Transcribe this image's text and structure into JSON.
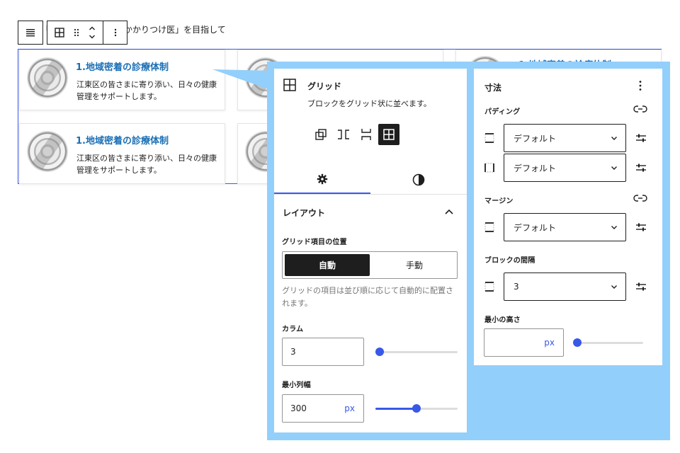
{
  "canvas": {
    "heading_text": "かかりつけ医」を目指して",
    "heading_prefix": "「",
    "cards": [
      {
        "title": "1.地域密着の診療体制",
        "desc": "江東区の皆さまに寄り添い、日々の健康管理をサポートします。"
      },
      {
        "title": "1.地域密着の診療体制",
        "desc": "江東区の皆さまに寄り添い、日々の健康管理をサポートします。"
      }
    ],
    "ghost_title": "1.地域密着の診療体制"
  },
  "block_toolbar": {
    "icons": [
      "list-view-icon",
      "grid-icon",
      "drag-handle-icon",
      "move-up-down-icon",
      "more-options-icon"
    ]
  },
  "grid_panel": {
    "title": "グリッド",
    "description": "ブロックをグリッド状に並べます。",
    "variations": [
      "group-icon",
      "row-icon",
      "stack-icon",
      "grid-icon"
    ],
    "tabs": [
      "settings-tab",
      "styles-tab"
    ],
    "layout_section": {
      "title": "レイアウト",
      "position_label": "グリッド項目の位置",
      "auto_label": "自動",
      "manual_label": "手動",
      "help": "グリッドの項目は並び順に応じて自動的に配置されます。",
      "columns_label": "カラム",
      "columns_value": "3",
      "columns_fraction": 0.05,
      "min_width_label": "最小列幅",
      "min_width_value": "300",
      "min_width_unit": "px",
      "min_width_fraction": 0.5
    }
  },
  "dimensions_panel": {
    "title": "寸法",
    "padding_label": "パディング",
    "padding_top_value": "デフォルト",
    "padding_side_value": "デフォルト",
    "margin_label": "マージン",
    "margin_value": "デフォルト",
    "block_gap_label": "ブロックの間隔",
    "block_gap_value": "3",
    "min_height_label": "最小の高さ",
    "min_height_value": "",
    "min_height_unit": "px"
  },
  "colors": {
    "accent": "#3858e9",
    "link": "#1a6fb5",
    "backdrop": "#93cffb",
    "text": "#1e1e1e"
  }
}
